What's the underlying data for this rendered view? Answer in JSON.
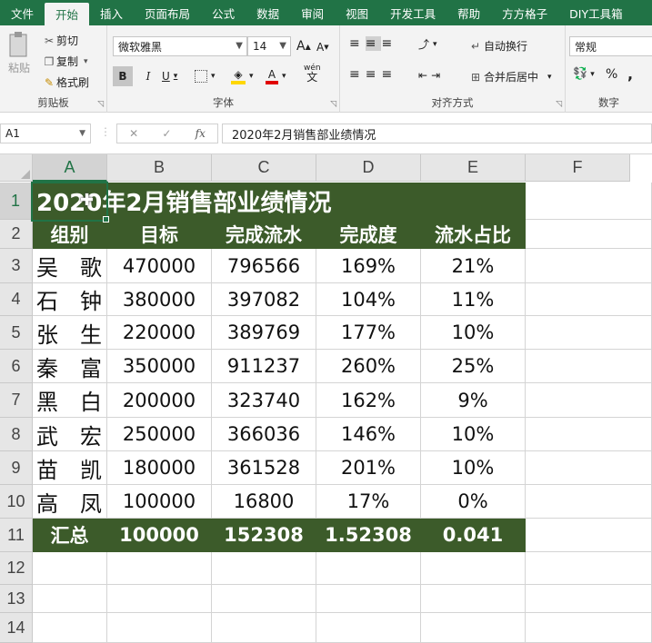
{
  "tabs": [
    "文件",
    "开始",
    "插入",
    "页面布局",
    "公式",
    "数据",
    "审阅",
    "视图",
    "开发工具",
    "帮助",
    "方方格子",
    "DIY工具箱"
  ],
  "ribbon": {
    "clipboard": {
      "paste": "粘贴",
      "cut": "剪切",
      "copy": "复制",
      "format_painter": "格式刷",
      "label": "剪贴板"
    },
    "font": {
      "name": "微软雅黑",
      "size": "14",
      "grow": "A",
      "shrink": "A",
      "bold": "B",
      "italic": "I",
      "underline": "U",
      "font_color": "A",
      "phonetic": "wén",
      "label": "字体"
    },
    "alignment": {
      "wrap": "自动换行",
      "merge": "合并后居中",
      "label": "对齐方式"
    },
    "number": {
      "format": "常规",
      "percent": "%",
      "comma": ",",
      "label": "数字"
    }
  },
  "formula_bar": {
    "name_box": "A1",
    "cancel": "✕",
    "enter": "✓",
    "fx": "fx",
    "content": "2020年2月销售部业绩情况"
  },
  "columns": [
    "A",
    "B",
    "C",
    "D",
    "E",
    "F"
  ],
  "rows": [
    "1",
    "2",
    "3",
    "4",
    "5",
    "6",
    "7",
    "8",
    "9",
    "10",
    "11",
    "12",
    "13",
    "14"
  ],
  "sheet": {
    "title": "2020年2月销售部业绩情况",
    "headers": [
      "组别",
      "目标",
      "完成流水",
      "完成度",
      "流水占比"
    ],
    "data": [
      [
        "吴　歌",
        "470000",
        "796566",
        "169%",
        "21%"
      ],
      [
        "石　钟",
        "380000",
        "397082",
        "104%",
        "11%"
      ],
      [
        "张　生",
        "220000",
        "389769",
        "177%",
        "10%"
      ],
      [
        "秦　富",
        "350000",
        "911237",
        "260%",
        "25%"
      ],
      [
        "黑　白",
        "200000",
        "323740",
        "162%",
        "9%"
      ],
      [
        "武　宏",
        "250000",
        "366036",
        "146%",
        "10%"
      ],
      [
        "苗　凯",
        "180000",
        "361528",
        "201%",
        "10%"
      ],
      [
        "高　凤",
        "100000",
        "16800",
        "17%",
        "0%"
      ]
    ],
    "total": [
      "汇总",
      "100000",
      "152308",
      "1.52308",
      "0.041"
    ]
  },
  "colors": {
    "accent": "#217346",
    "table_dark": "#3c5b2a"
  }
}
